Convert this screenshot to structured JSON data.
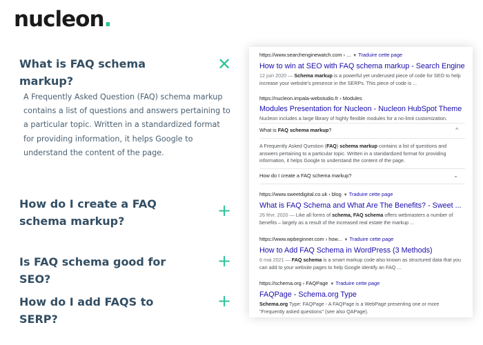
{
  "logo": {
    "text": "nucleon",
    "dot": ".",
    "accent_color": "#2cc29b"
  },
  "faq": {
    "items": [
      {
        "question": "What is FAQ schema markup?",
        "toggle": "✕",
        "expanded": true,
        "answer": "A Frequently Asked Question (FAQ) schema markup contains a list of questions and answers pertaining to a particular topic. Written in a standardized format for providing information, it helps Google to understand the content of the page."
      },
      {
        "question": "How do I create a FAQ schema markup?",
        "toggle": "+",
        "expanded": false
      },
      {
        "question": "Is FAQ schema good for SEO?",
        "toggle": "+",
        "expanded": false
      },
      {
        "question": "How do I add FAQS to SERP?",
        "toggle": "+",
        "expanded": false
      }
    ]
  },
  "serp": {
    "results": [
      {
        "url": "https://www.searchenginewatch.com › ...",
        "translate": "Traduire cette page",
        "title": "How to win at SEO with FAQ schema markup - Search Engine ...",
        "date": "12 juin 2020 —",
        "snippet_bold": "Schema markup",
        "snippet_rest": " is a powerful yet underused piece of code for SEO to help increase your website's presence in the SERPs. This piece of code is ..."
      },
      {
        "url": "https://nucleon.impala-webstudio.fr › Modules",
        "translate": "",
        "title": "Modules Presentation for Nucleon - Nucleon HubSpot Theme",
        "snippet_rest": "Nucleon includes a large library of highly flexible modules for a no-limit customization."
      },
      {
        "url": "https://www.sweetdigital.co.uk › blog",
        "translate": "Traduire cette page",
        "title": "What is FAQ Schema and What Are The Benefits? - Sweet ...",
        "date": "26 févr. 2020 —",
        "snippet_pre": "Like all forms of ",
        "snippet_bold": "schema, FAQ schema",
        "snippet_rest": " offers webmasters a number of benefits – largely as a result of the increased real estate the markup ..."
      },
      {
        "url": "https://www.wpbeginner.com › how...",
        "translate": "Traduire cette page",
        "title": "How to Add FAQ Schema in WordPress (3 Methods)",
        "date": "6 mai 2021 —",
        "snippet_bold": "FAQ schema",
        "snippet_rest": " is a smart markup code also known as structured data that you can add to your website pages to help Google identify an FAQ ..."
      },
      {
        "url": "https://schema.org › FAQPage",
        "translate": "Traduire cette page",
        "title": "FAQPage - Schema.org Type",
        "snippet_bold": "Schema.org",
        "snippet_rest": " Type: FAQPage - A FAQPage is a WebPage presenting one or more \"Frequently asked questions\" (see also QAPage)."
      }
    ],
    "paa": {
      "q1_pre": "What is ",
      "q1_bold": "FAQ schema markup",
      "q1_post": "?",
      "answer_pre": "A Frequently Asked Question (",
      "answer_b1": "FAQ",
      "answer_mid": ") ",
      "answer_b2": "schema markup",
      "answer_post": " contains a list of questions and answers pertaining to a particular topic. Written in a standardized format for providing information, it helps Google to understand the content of the page.",
      "q2": "How do I create a FAQ schema markup?",
      "chev_up": "^",
      "chev_down": "⌄"
    }
  }
}
